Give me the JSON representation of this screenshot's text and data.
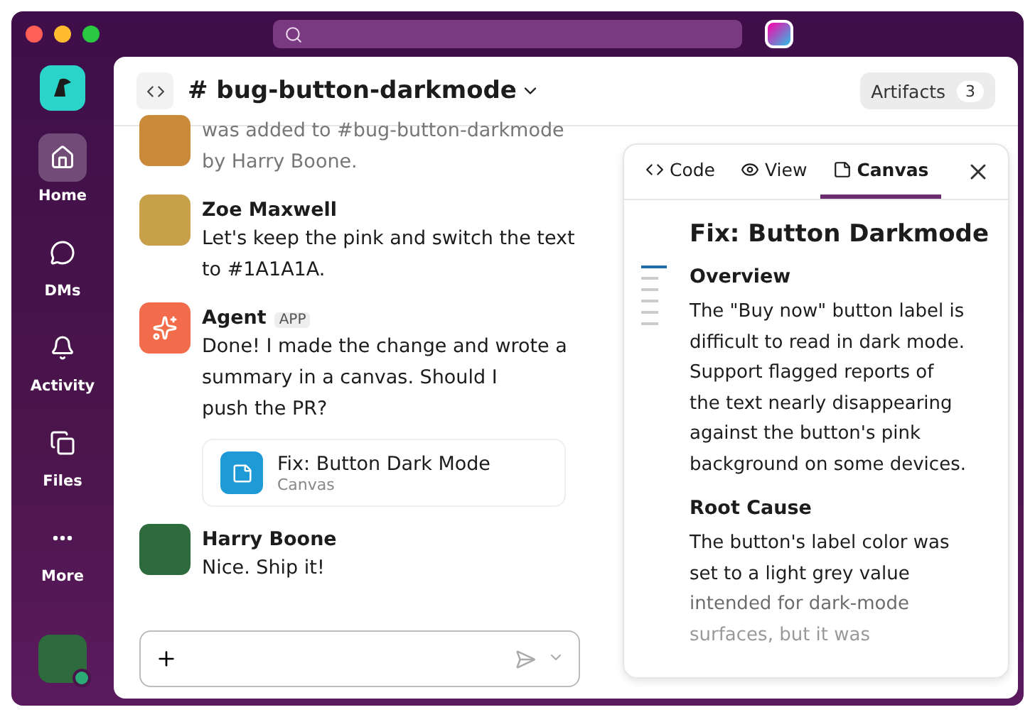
{
  "sidebar": {
    "items": [
      {
        "label": "Home",
        "selected": true
      },
      {
        "label": "DMs",
        "selected": false
      },
      {
        "label": "Activity",
        "selected": false
      },
      {
        "label": "Files",
        "selected": false
      },
      {
        "label": "More",
        "selected": false
      }
    ],
    "user_online": true
  },
  "channel": {
    "name": "# bug-button-darkmode",
    "artifacts_label": "Artifacts",
    "artifacts_count": "3"
  },
  "messages": [
    {
      "kind": "system",
      "lines": [
        "was added to #bug-button-darkmode",
        "by Harry Boone."
      ]
    },
    {
      "kind": "user",
      "author": "Zoe Maxwell",
      "lines": [
        "Let's keep the pink and switch the text",
        "to #1A1A1A."
      ]
    },
    {
      "kind": "app",
      "author": "Agent",
      "badge": "APP",
      "lines": [
        "Done! I made the change and wrote a",
        "summary in a canvas. Should I",
        "push the PR?"
      ],
      "attachment": {
        "title": "Fix: Button Dark Mode",
        "subtitle": "Canvas"
      }
    },
    {
      "kind": "user",
      "author": "Harry Boone",
      "lines": [
        "Nice. Ship it!"
      ]
    }
  ],
  "panel": {
    "tabs": [
      {
        "label": "Code",
        "selected": false
      },
      {
        "label": "View",
        "selected": false
      },
      {
        "label": "Canvas",
        "selected": true
      }
    ],
    "title": "Fix: Button Darkmode",
    "sections": [
      {
        "heading": "Overview",
        "lines": [
          "The \"Buy now\" button label is",
          "difficult to read in dark mode.",
          "Support flagged reports of",
          "the text nearly disappearing",
          "against the button's pink",
          "background on some devices."
        ]
      },
      {
        "heading": "Root Cause",
        "lines": [
          "The button's label color was",
          "set to a light grey value",
          "intended for dark-mode",
          "surfaces, but it was"
        ]
      }
    ]
  }
}
